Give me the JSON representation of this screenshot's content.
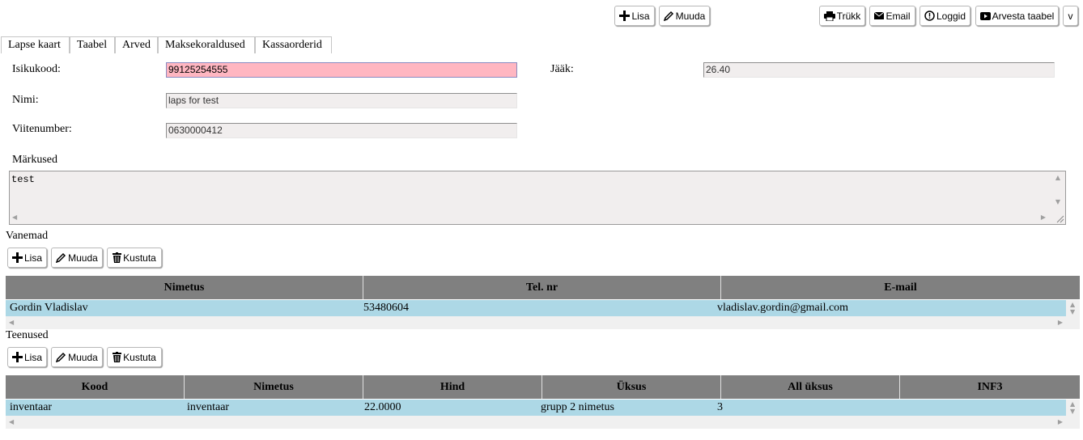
{
  "toolbar": {
    "lisa": "Lisa",
    "muuda": "Muuda",
    "trukk": "Trükk",
    "email": "Email",
    "loggid": "Loggid",
    "arvesta": "Arvesta taabel",
    "more": "v"
  },
  "tabs": [
    "Lapse kaart",
    "Taabel",
    "Arved",
    "Maksekoraldused",
    "Kassaorderid"
  ],
  "form": {
    "isikukood_label": "Isikukood:",
    "isikukood_value": "99125254555",
    "nimi_label": "Nimi:",
    "nimi_value": "laps for test",
    "viitenumber_label": "Viitenumber:",
    "viitenumber_value": "0630000412",
    "jaak_label": "Jääk:",
    "jaak_value": "26.40",
    "markused_label": "Märkused",
    "markused_value": "test"
  },
  "vanemad": {
    "title": "Vanemad",
    "buttons": {
      "lisa": "Lisa",
      "muuda": "Muuda",
      "kustuta": "Kustuta"
    },
    "columns": [
      "Nimetus",
      "Tel. nr",
      "E-mail"
    ],
    "rows": [
      [
        "Gordin Vladislav",
        "53480604",
        "vladislav.gordin@gmail.com"
      ]
    ]
  },
  "teenused": {
    "title": "Teenused",
    "buttons": {
      "lisa": "Lisa",
      "muuda": "Muuda",
      "kustuta": "Kustuta"
    },
    "columns": [
      "Kood",
      "Nimetus",
      "Hind",
      "Üksus",
      "All üksus",
      "INF3"
    ],
    "rows": [
      [
        "inventaar",
        "inventaar",
        "22.0000",
        "grupp 2 nimetus",
        "3",
        ""
      ]
    ]
  }
}
